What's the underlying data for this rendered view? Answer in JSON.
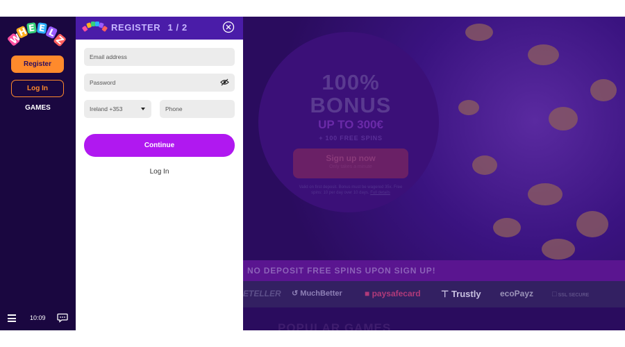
{
  "brand": {
    "name": "WHEELZ",
    "mini_logo": "WHEELZ"
  },
  "sidebar": {
    "register_label": "Register",
    "login_label": "Log In",
    "games_label": "GAMES",
    "clock": "10:09",
    "icons": [
      "menu-icon",
      "chat-icon"
    ]
  },
  "register_panel": {
    "title": "REGISTER",
    "step": "1 / 2",
    "email_placeholder": "Email address",
    "password_placeholder": "Password",
    "country_value": "Ireland +353",
    "phone_placeholder": "Phone",
    "continue_label": "Continue",
    "login_link": "Log In",
    "accent": "#b018f0",
    "header_color": "#4a1ca8"
  },
  "hero": {
    "line1": "100%",
    "line2": "BONUS",
    "line3": "UP TO 300€",
    "line4": "+ 100 FREE SPINS",
    "cta": "Sign up now",
    "cta_sub": "Only takes a minute",
    "terms": "Valid on first deposit. Bonus must be wagered 35x. Free spins: 10 per day over 10 days.",
    "terms_link": "Full details"
  },
  "banner": {
    "text": "NO DEPOSIT FREE SPINS UPON SIGN UP!"
  },
  "payments": {
    "items": [
      {
        "name": "ETELLER",
        "color": "#5d4f8a"
      },
      {
        "name": "MuchBetter",
        "color": "#8d7fb5"
      },
      {
        "name": "paysafecard",
        "color": "#b13a7a"
      },
      {
        "name": "Trustly",
        "color": "#c8c0e0"
      },
      {
        "name": "ecoPayz",
        "color": "#9b93b8"
      },
      {
        "name": "SSL SECURE",
        "color": "#5f5188"
      }
    ]
  },
  "section": {
    "heading": "POPULAR GAMES"
  }
}
